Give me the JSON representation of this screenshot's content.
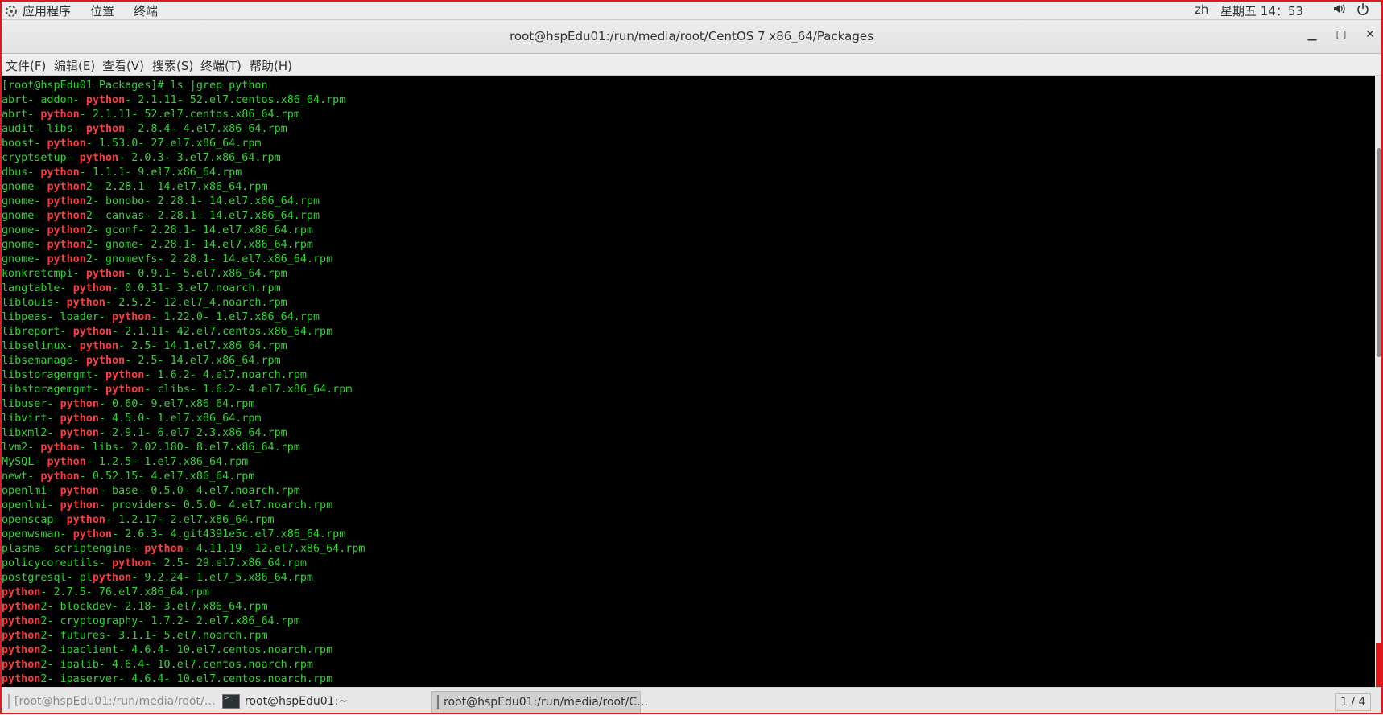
{
  "top_panel": {
    "apps": "应用程序",
    "places": "位置",
    "terminal": "终端",
    "lang": "zh",
    "clock": "星期五 14：53",
    "volume_icon": "volume-icon",
    "power_icon": "power-icon"
  },
  "window": {
    "title": "root@hspEdu01:/run/media/root/CentOS 7 x86_64/Packages",
    "minimize": "▁",
    "maximize": "▢",
    "close": "✕"
  },
  "menu": [
    "文件(F)",
    "编辑(E)",
    "查看(V)",
    "搜索(S)",
    "终端(T)",
    "帮助(H)"
  ],
  "terminal": {
    "prompt": "[root@hspEdu01 Packages]# ls |grep python",
    "lines": [
      [
        "abrt- addon- ",
        "python",
        "- 2.1.11- 52.el7.centos.x86_64.rpm"
      ],
      [
        "abrt- ",
        "python",
        "- 2.1.11- 52.el7.centos.x86_64.rpm"
      ],
      [
        "audit- libs- ",
        "python",
        "- 2.8.4- 4.el7.x86_64.rpm"
      ],
      [
        "boost- ",
        "python",
        "- 1.53.0- 27.el7.x86_64.rpm"
      ],
      [
        "cryptsetup- ",
        "python",
        "- 2.0.3- 3.el7.x86_64.rpm"
      ],
      [
        "dbus- ",
        "python",
        "- 1.1.1- 9.el7.x86_64.rpm"
      ],
      [
        "gnome- ",
        "python",
        "2- 2.28.1- 14.el7.x86_64.rpm"
      ],
      [
        "gnome- ",
        "python",
        "2- bonobo- 2.28.1- 14.el7.x86_64.rpm"
      ],
      [
        "gnome- ",
        "python",
        "2- canvas- 2.28.1- 14.el7.x86_64.rpm"
      ],
      [
        "gnome- ",
        "python",
        "2- gconf- 2.28.1- 14.el7.x86_64.rpm"
      ],
      [
        "gnome- ",
        "python",
        "2- gnome- 2.28.1- 14.el7.x86_64.rpm"
      ],
      [
        "gnome- ",
        "python",
        "2- gnomevfs- 2.28.1- 14.el7.x86_64.rpm"
      ],
      [
        "konkretcmpi- ",
        "python",
        "- 0.9.1- 5.el7.x86_64.rpm"
      ],
      [
        "langtable- ",
        "python",
        "- 0.0.31- 3.el7.noarch.rpm"
      ],
      [
        "liblouis- ",
        "python",
        "- 2.5.2- 12.el7_4.noarch.rpm"
      ],
      [
        "libpeas- loader- ",
        "python",
        "- 1.22.0- 1.el7.x86_64.rpm"
      ],
      [
        "libreport- ",
        "python",
        "- 2.1.11- 42.el7.centos.x86_64.rpm"
      ],
      [
        "libselinux- ",
        "python",
        "- 2.5- 14.1.el7.x86_64.rpm"
      ],
      [
        "libsemanage- ",
        "python",
        "- 2.5- 14.el7.x86_64.rpm"
      ],
      [
        "libstoragemgmt- ",
        "python",
        "- 1.6.2- 4.el7.noarch.rpm"
      ],
      [
        "libstoragemgmt- ",
        "python",
        "- clibs- 1.6.2- 4.el7.x86_64.rpm"
      ],
      [
        "libuser- ",
        "python",
        "- 0.60- 9.el7.x86_64.rpm"
      ],
      [
        "libvirt- ",
        "python",
        "- 4.5.0- 1.el7.x86_64.rpm"
      ],
      [
        "libxml2- ",
        "python",
        "- 2.9.1- 6.el7_2.3.x86_64.rpm"
      ],
      [
        "lvm2- ",
        "python",
        "- libs- 2.02.180- 8.el7.x86_64.rpm"
      ],
      [
        "MySQL- ",
        "python",
        "- 1.2.5- 1.el7.x86_64.rpm"
      ],
      [
        "newt- ",
        "python",
        "- 0.52.15- 4.el7.x86_64.rpm"
      ],
      [
        "openlmi- ",
        "python",
        "- base- 0.5.0- 4.el7.noarch.rpm"
      ],
      [
        "openlmi- ",
        "python",
        "- providers- 0.5.0- 4.el7.noarch.rpm"
      ],
      [
        "openscap- ",
        "python",
        "- 1.2.17- 2.el7.x86_64.rpm"
      ],
      [
        "openwsman- ",
        "python",
        "- 2.6.3- 4.git4391e5c.el7.x86_64.rpm"
      ],
      [
        "plasma- scriptengine- ",
        "python",
        "- 4.11.19- 12.el7.x86_64.rpm"
      ],
      [
        "policycoreutils- ",
        "python",
        "- 2.5- 29.el7.x86_64.rpm"
      ],
      [
        "postgresql- pl",
        "python",
        "- 9.2.24- 1.el7_5.x86_64.rpm"
      ],
      [
        "",
        "python",
        "- 2.7.5- 76.el7.x86_64.rpm"
      ],
      [
        "",
        "python",
        "2- blockdev- 2.18- 3.el7.x86_64.rpm"
      ],
      [
        "",
        "python",
        "2- cryptography- 1.7.2- 2.el7.x86_64.rpm"
      ],
      [
        "",
        "python",
        "2- futures- 3.1.1- 5.el7.noarch.rpm"
      ],
      [
        "",
        "python",
        "2- ipaclient- 4.6.4- 10.el7.centos.noarch.rpm"
      ],
      [
        "",
        "python",
        "2- ipalib- 4.6.4- 10.el7.centos.noarch.rpm"
      ],
      [
        "",
        "python",
        "2- ipaserver- 4.6.4- 10.el7.centos.noarch.rpm"
      ]
    ]
  },
  "taskbar": {
    "tasks": [
      {
        "label": "[root@hspEdu01:/run/media/root/…",
        "state": "dim"
      },
      {
        "label": "root@hspEdu01:~",
        "state": "normal"
      },
      {
        "label": "root@hspEdu01:/run/media/root/C…",
        "state": "active"
      }
    ],
    "pager": "1 / 4"
  },
  "colors": {
    "terminal_bg": "#000000",
    "terminal_fg": "#2fd62f",
    "highlight": "#ff3b3b",
    "frame": "#e0191c"
  }
}
